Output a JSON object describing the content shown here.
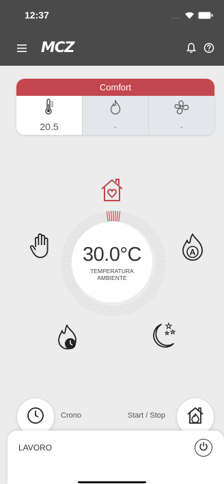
{
  "status": {
    "time": "12:37",
    "icons": [
      "signal-dots-icon",
      "wifi-icon",
      "battery-icon"
    ]
  },
  "nav": {
    "logo": "MCZ",
    "icons": [
      "menu-icon",
      "bell-icon",
      "help-icon"
    ]
  },
  "card": {
    "mode": "Comfort",
    "temperature": "20.5",
    "flame_value": "-",
    "fan_value": "-"
  },
  "dial": {
    "temperature": "30.0°C",
    "label_line1": "TEMPERATURA",
    "label_line2": "AMBIENTE"
  },
  "actions": {
    "crono_label": "Crono",
    "start_stop_label": "Start / Stop"
  },
  "bottom": {
    "status": "LAVORO"
  },
  "colors": {
    "header_bg": "#4a4a4a",
    "accent_red": "#c4474f",
    "background": "#ececec"
  }
}
